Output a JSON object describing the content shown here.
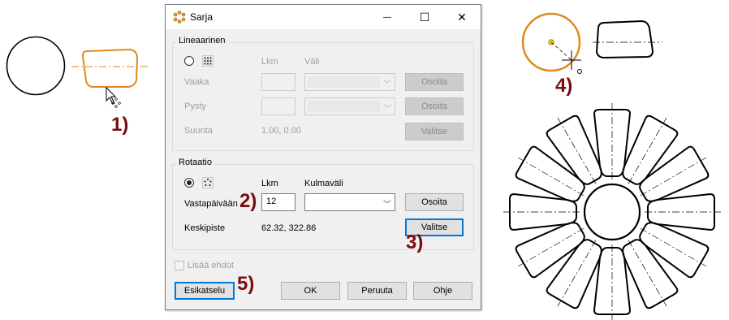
{
  "steps": {
    "s1": "1)",
    "s2": "2)",
    "s3": "3)",
    "s4": "4)",
    "s5": "5)"
  },
  "dialog": {
    "title": "Sarja",
    "window_buttons": {
      "minimize": "—",
      "maximize": "☐",
      "close": "✕"
    },
    "linear": {
      "group_label": "Lineaarinen",
      "col_count": "Lkm",
      "col_spacing": "Väli",
      "row1_label": "Vaaka",
      "row1_button": "Osoita",
      "row2_label": "Pysty",
      "row2_button": "Osoita",
      "direction_label": "Suunta",
      "direction_value": "1.00, 0.00",
      "direction_button": "Valitse"
    },
    "rotation": {
      "group_label": "Rotaatio",
      "col_count": "Lkm",
      "col_angle": "Kulmaväli",
      "direction_label": "Vastapäivään",
      "count_value": "12",
      "angle_button": "Osoita",
      "center_label": "Keskipiste",
      "center_value": "62.32, 322.86",
      "center_button": "Valitse"
    },
    "add_dims_label": "Lisää ehdot",
    "preview_button": "Esikatselu",
    "ok_button": "OK",
    "cancel_button": "Peruuta",
    "help_button": "Ohje"
  },
  "colors": {
    "accent_orange": "#e08a1e",
    "step_label": "#7b0c0c",
    "focus_blue": "#0078d7"
  },
  "petal_count": 12
}
